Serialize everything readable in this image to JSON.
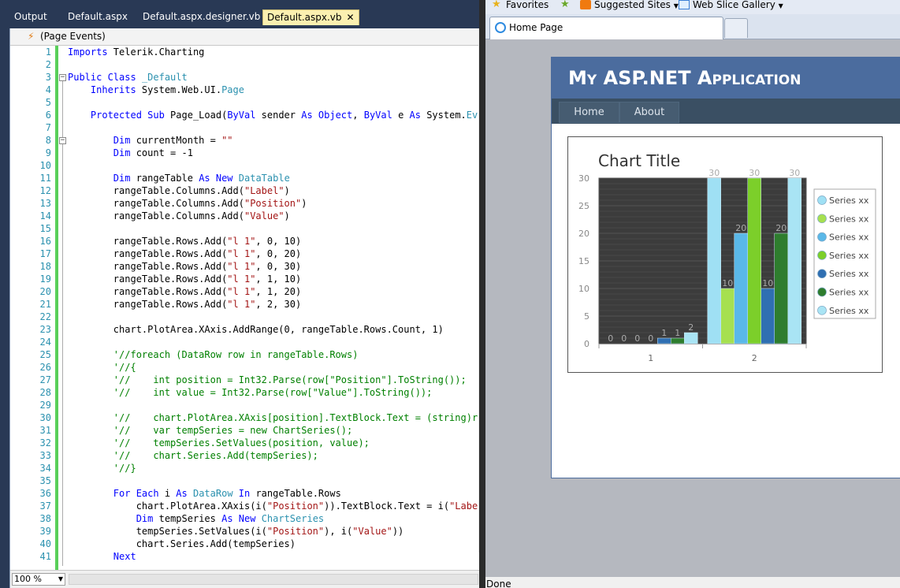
{
  "vs": {
    "tabs": [
      {
        "label": "Output"
      },
      {
        "label": "Default.aspx"
      },
      {
        "label": "Default.aspx.designer.vb"
      },
      {
        "label": "Default.aspx.vb",
        "close": "✕"
      }
    ],
    "nav_dropdown": "(Page Events)",
    "zoom": "100 %",
    "code_lines": [
      {
        "n": "1",
        "html": "<span class=\"kw\">Imports</span> Telerik.Charting"
      },
      {
        "n": "2",
        "html": ""
      },
      {
        "n": "3",
        "html": "<span class=\"kw\">Public Class</span> <span class=\"ty\">_Default</span>"
      },
      {
        "n": "4",
        "html": "    <span class=\"kw\">Inherits</span> System.Web.UI.<span class=\"ty\">Page</span>"
      },
      {
        "n": "5",
        "html": ""
      },
      {
        "n": "6",
        "html": "    <span class=\"kw\">Protected Sub</span> Page_Load(<span class=\"kw\">ByVal</span> sender <span class=\"kw\">As Object</span>, <span class=\"kw\">ByVal</span> e <span class=\"kw\">As</span> System.<span class=\"ty\">EventArgs</span>"
      },
      {
        "n": "7",
        "html": ""
      },
      {
        "n": "8",
        "html": "        <span class=\"kw\">Dim</span> currentMonth = <span class=\"st\">\"\"</span>"
      },
      {
        "n": "9",
        "html": "        <span class=\"kw\">Dim</span> count = -1"
      },
      {
        "n": "10",
        "html": ""
      },
      {
        "n": "11",
        "html": "        <span class=\"kw\">Dim</span> rangeTable <span class=\"kw\">As New</span> <span class=\"ty\">DataTable</span>"
      },
      {
        "n": "12",
        "html": "        rangeTable.Columns.Add(<span class=\"st\">\"Label\"</span>)"
      },
      {
        "n": "13",
        "html": "        rangeTable.Columns.Add(<span class=\"st\">\"Position\"</span>)"
      },
      {
        "n": "14",
        "html": "        rangeTable.Columns.Add(<span class=\"st\">\"Value\"</span>)"
      },
      {
        "n": "15",
        "html": ""
      },
      {
        "n": "16",
        "html": "        rangeTable.Rows.Add(<span class=\"st\">\"l 1\"</span>, 0, 10)"
      },
      {
        "n": "17",
        "html": "        rangeTable.Rows.Add(<span class=\"st\">\"l 1\"</span>, 0, 20)"
      },
      {
        "n": "18",
        "html": "        rangeTable.Rows.Add(<span class=\"st\">\"l 1\"</span>, 0, 30)"
      },
      {
        "n": "19",
        "html": "        rangeTable.Rows.Add(<span class=\"st\">\"l 1\"</span>, 1, 10)"
      },
      {
        "n": "20",
        "html": "        rangeTable.Rows.Add(<span class=\"st\">\"l 1\"</span>, 1, 20)"
      },
      {
        "n": "21",
        "html": "        rangeTable.Rows.Add(<span class=\"st\">\"l 1\"</span>, 2, 30)"
      },
      {
        "n": "22",
        "html": ""
      },
      {
        "n": "23",
        "html": "        chart.PlotArea.XAxis.AddRange(0, rangeTable.Rows.Count, 1)"
      },
      {
        "n": "24",
        "html": ""
      },
      {
        "n": "25",
        "html": "        <span class=\"cm\">'//foreach (DataRow row in rangeTable.Rows)</span>"
      },
      {
        "n": "26",
        "html": "        <span class=\"cm\">'//{</span>"
      },
      {
        "n": "27",
        "html": "        <span class=\"cm\">'//    int position = Int32.Parse(row[\"Position\"].ToString());</span>"
      },
      {
        "n": "28",
        "html": "        <span class=\"cm\">'//    int value = Int32.Parse(row[\"Value\"].ToString());</span>"
      },
      {
        "n": "29",
        "html": ""
      },
      {
        "n": "30",
        "html": "        <span class=\"cm\">'//    chart.PlotArea.XAxis[position].TextBlock.Text = (string)row[</span>"
      },
      {
        "n": "31",
        "html": "        <span class=\"cm\">'//    var tempSeries = new ChartSeries();</span>"
      },
      {
        "n": "32",
        "html": "        <span class=\"cm\">'//    tempSeries.SetValues(position, value);</span>"
      },
      {
        "n": "33",
        "html": "        <span class=\"cm\">'//    chart.Series.Add(tempSeries);</span>"
      },
      {
        "n": "34",
        "html": "        <span class=\"cm\">'//}</span>"
      },
      {
        "n": "35",
        "html": ""
      },
      {
        "n": "36",
        "html": "        <span class=\"kw\">For Each</span> i <span class=\"kw\">As</span> <span class=\"ty\">DataRow</span> <span class=\"kw\">In</span> rangeTable.Rows"
      },
      {
        "n": "37",
        "html": "            chart.PlotArea.XAxis(i(<span class=\"st\">\"Position\"</span>)).TextBlock.Text = i(<span class=\"st\">\"Label\"</span>)"
      },
      {
        "n": "38",
        "html": "            <span class=\"kw\">Dim</span> tempSeries <span class=\"kw\">As New</span> <span class=\"ty\">ChartSeries</span>"
      },
      {
        "n": "39",
        "html": "            tempSeries.SetValues(i(<span class=\"st\">\"Position\"</span>), i(<span class=\"st\">\"Value\"</span>))"
      },
      {
        "n": "40",
        "html": "            chart.Series.Add(tempSeries)"
      },
      {
        "n": "41",
        "html": "        <span class=\"kw\">Next</span>"
      }
    ]
  },
  "ie": {
    "favorites": "Favorites",
    "suggested_sites": "Suggested Sites",
    "web_slice_gallery": "Web Slice Gallery",
    "tab_title": "Home Page",
    "status": "Done",
    "site_title": "My ASP.NET Application",
    "menu": [
      "Home",
      "About"
    ],
    "colors": {
      "header": "#4b6c9e",
      "menu": "#3a4f63",
      "menu_item": "#465c71"
    }
  },
  "chart_data": {
    "type": "bar",
    "title": "Chart Title",
    "categories": [
      "1",
      "2"
    ],
    "ylim": [
      0,
      30
    ],
    "yticks": [
      "0",
      "5",
      "10",
      "15",
      "20",
      "25",
      "30"
    ],
    "series": [
      {
        "name": "Series xx",
        "color": "#9fe0f4",
        "values": [
          0,
          30
        ]
      },
      {
        "name": "Series xx",
        "color": "#a6e050",
        "values": [
          0,
          10
        ]
      },
      {
        "name": "Series xx",
        "color": "#5ab8e8",
        "values": [
          0,
          20
        ]
      },
      {
        "name": "Series xx",
        "color": "#7ccf2a",
        "values": [
          0,
          30
        ]
      },
      {
        "name": "Series xx",
        "color": "#2f6fb2",
        "values": [
          1,
          10
        ]
      },
      {
        "name": "Series xx",
        "color": "#2e7d2e",
        "values": [
          1,
          20
        ]
      },
      {
        "name": "Series xx",
        "color": "#a9e4f4",
        "values": [
          2,
          30
        ]
      }
    ],
    "grid": true,
    "legend": "right"
  }
}
